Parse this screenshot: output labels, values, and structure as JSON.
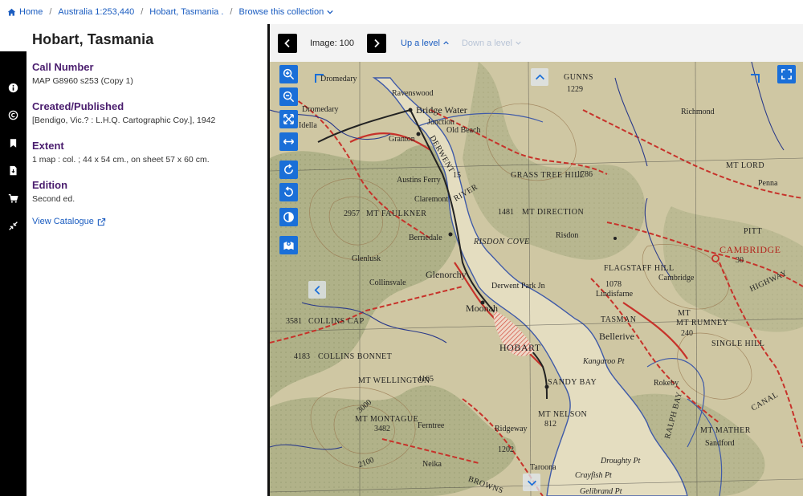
{
  "breadcrumb": {
    "home": "Home",
    "collection": "Australia 1:253,440",
    "item": "Hobart, Tasmania .",
    "browse": "Browse this collection"
  },
  "record": {
    "title": "Hobart, Tasmania",
    "call_number_label": "Call Number",
    "call_number": "MAP G8960 s253 (Copy 1)",
    "created_label": "Created/Published",
    "created": "[Bendigo, Vic.? : L.H.Q. Cartographic Coy.], 1942",
    "extent_label": "Extent",
    "extent": "1 map : col. ; 44 x 54 cm., on sheet 57 x 60 cm.",
    "edition_label": "Edition",
    "edition": "Second ed.",
    "view_catalogue": "View Catalogue"
  },
  "rail_icons": [
    "info-icon",
    "copyright-icon",
    "bookmark-icon",
    "file-icon",
    "cart-icon",
    "collapse-icon"
  ],
  "viewer": {
    "image_label": "Image: 100",
    "up_level": "Up a level",
    "down_level": "Down a level"
  },
  "map_labels": {
    "dromedary_top": "Dromedary",
    "dromedary": "Dromedary",
    "idella": "Idella",
    "ravenswood": "Ravenswood",
    "bridge_water": "Bridge Water",
    "junction": "Junction",
    "old_beach": "Old Beach",
    "granton": "Granton",
    "gunns": "GUNNS",
    "richmond": "Richmond",
    "mt_lord": "MT LORD",
    "penna": "Penna",
    "derwent": "DERWENT",
    "river": "RIVER",
    "austins_ferry": "Austins Ferry",
    "claremont": "Claremont",
    "grass_tree_hill": "GRASS TREE HILL",
    "mt_direction": "MT DIRECTION",
    "mt_faulkner": "MT FAULKNER",
    "berriedale": "Berriedale",
    "risdon_cove": "RISDON COVE",
    "risdon": "Risdon",
    "pitt": "PITT",
    "cambridge_cap": "CAMBRIDGE",
    "cambridge": "Cambridge",
    "glenlusk": "Glenlusk",
    "collinsvale": "Collinsvale",
    "glenorchy": "Glenorchy",
    "derwent_park": "Derwent Park Jn",
    "flagstaff_hill": "FLAGSTAFF HILL",
    "lindisfarne": "Lindisfarne",
    "moonah": "Moonah",
    "highway": "HIGHWAY",
    "collins_cap": "COLLINS CAP",
    "tasman": "TASMAN",
    "bellerive": "Bellerive",
    "mt_rumney": "MT RUMNEY",
    "hobart": "HOBART",
    "collins_bonnet": "COLLINS BONNET",
    "kangaroo_pt": "Kangaroo Pt",
    "single_hill": "SINGLE HILL",
    "sandy_bay": "SANDY BAY",
    "mt_wellington": "MT WELLINGTON",
    "rokeby": "Rokeby",
    "canal": "CANAL",
    "mt_montague": "MT MONTAGUE",
    "ferntree": "Ferntree",
    "mt_nelson": "MT NELSON",
    "ridgeway": "Ridgeway",
    "mt_mather": "MT MATHER",
    "sandford": "Sandford",
    "ralph_bay": "RALPH BAY",
    "neika": "Neika",
    "taroona": "Taroona",
    "droughty_pt": "Droughty Pt",
    "crayfish_pt": "Crayfish Pt",
    "gelibrand_pt": "Gelibrand Pt",
    "browns": "BROWNS",
    "elev_1229": "1229",
    "elev_1786": "1786",
    "elev_1481": "1481",
    "elev_2957": "2957",
    "elev_3581": "3581",
    "elev_4183": "4183",
    "elev_4165": "4165",
    "elev_3482": "3482",
    "elev_1078": "1078",
    "elev_240": "240",
    "elev_1202": "1202",
    "elev_812": "812",
    "elev_3000": "3000",
    "elev_2100": "2100",
    "elev_15": "15",
    "elev_30": "30",
    "mt_prefix": "MT"
  }
}
